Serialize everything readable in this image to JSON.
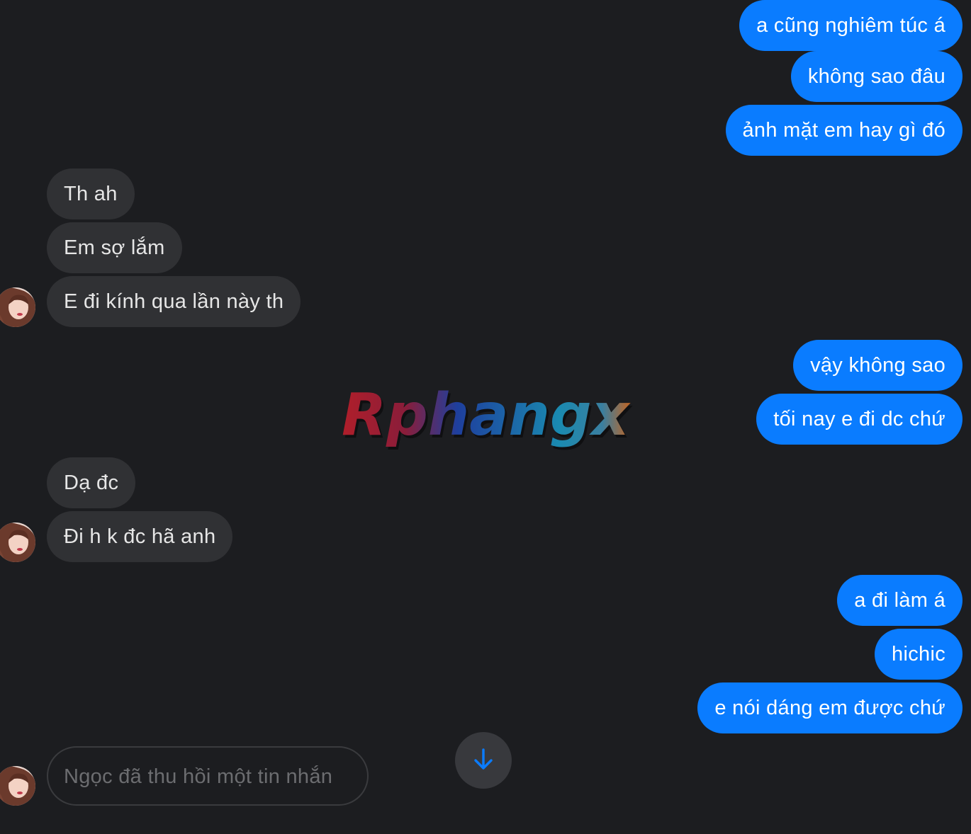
{
  "conversation": {
    "groups": [
      {
        "direction": "outgoing",
        "messages": [
          "a cũng nghiêm túc á",
          "không sao đâu",
          "ảnh mặt em hay gì đó"
        ]
      },
      {
        "direction": "incoming",
        "messages": [
          "Th ah",
          "Em sợ lắm",
          "E đi kính qua lần này th"
        ]
      },
      {
        "direction": "outgoing",
        "messages": [
          "vậy không sao",
          "tối nay e đi dc chứ"
        ]
      },
      {
        "direction": "incoming",
        "messages": [
          "Dạ đc",
          "Đi h k đc hã anh"
        ]
      },
      {
        "direction": "outgoing",
        "messages": [
          "a đi làm á",
          "hichic",
          "e nói dáng em được chứ"
        ]
      }
    ],
    "recalled_notice": "Ngọc đã thu hồi một tin nhắn",
    "scroll_down_icon": "arrow-down-icon",
    "avatar_icon": "contact-avatar"
  },
  "watermark": {
    "text": "Rphangx"
  },
  "colors": {
    "background": "#1c1d20",
    "outgoing_bubble": "#0a7cff",
    "incoming_bubble": "#303134",
    "accent": "#0a7cff"
  }
}
